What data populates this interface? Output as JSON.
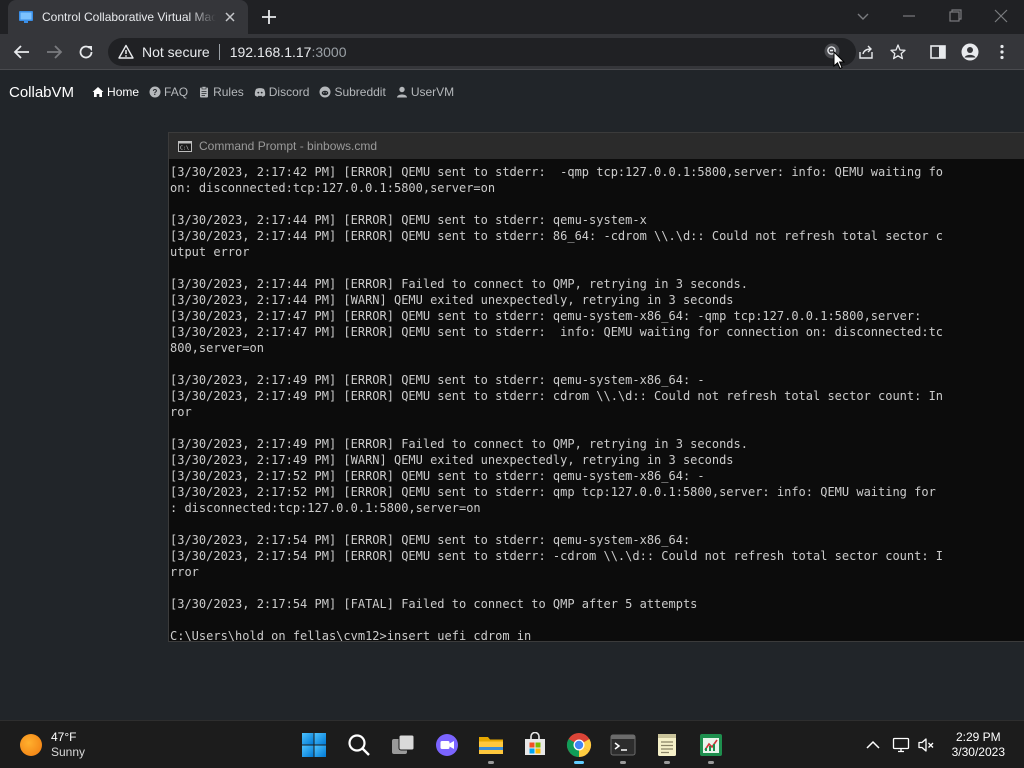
{
  "browser": {
    "tab_title": "Control Collaborative Virtual Machine",
    "security_label": "Not secure",
    "url_host": "192.168.1.17",
    "url_port": ":3000"
  },
  "site": {
    "brand": "CollabVM",
    "nav": [
      {
        "label": "Home",
        "icon": "home-icon"
      },
      {
        "label": "FAQ",
        "icon": "question-icon"
      },
      {
        "label": "Rules",
        "icon": "clipboard-icon"
      },
      {
        "label": "Discord",
        "icon": "discord-icon"
      },
      {
        "label": "Subreddit",
        "icon": "reddit-icon"
      },
      {
        "label": "UserVM",
        "icon": "user-icon"
      }
    ]
  },
  "vm": {
    "window_title": "Command Prompt - binbows.cmd",
    "console_lines": [
      "[3/30/2023, 2:17:42 PM] [ERROR] QEMU sent to stderr:  -qmp tcp:127.0.0.1:5800,server: info: QEMU waiting fo",
      "on: disconnected:tcp:127.0.0.1:5800,server=on",
      "",
      "[3/30/2023, 2:17:44 PM] [ERROR] QEMU sent to stderr: qemu-system-x",
      "[3/30/2023, 2:17:44 PM] [ERROR] QEMU sent to stderr: 86_64: -cdrom \\\\.\\d:: Could not refresh total sector c",
      "utput error",
      "",
      "[3/30/2023, 2:17:44 PM] [ERROR] Failed to connect to QMP, retrying in 3 seconds.",
      "[3/30/2023, 2:17:44 PM] [WARN] QEMU exited unexpectedly, retrying in 3 seconds",
      "[3/30/2023, 2:17:47 PM] [ERROR] QEMU sent to stderr: qemu-system-x86_64: -qmp tcp:127.0.0.1:5800,server:",
      "[3/30/2023, 2:17:47 PM] [ERROR] QEMU sent to stderr:  info: QEMU waiting for connection on: disconnected:tc",
      "800,server=on",
      "",
      "[3/30/2023, 2:17:49 PM] [ERROR] QEMU sent to stderr: qemu-system-x86_64: -",
      "[3/30/2023, 2:17:49 PM] [ERROR] QEMU sent to stderr: cdrom \\\\.\\d:: Could not refresh total sector count: In",
      "ror",
      "",
      "[3/30/2023, 2:17:49 PM] [ERROR] Failed to connect to QMP, retrying in 3 seconds.",
      "[3/30/2023, 2:17:49 PM] [WARN] QEMU exited unexpectedly, retrying in 3 seconds",
      "[3/30/2023, 2:17:52 PM] [ERROR] QEMU sent to stderr: qemu-system-x86_64: -",
      "[3/30/2023, 2:17:52 PM] [ERROR] QEMU sent to stderr: qmp tcp:127.0.0.1:5800,server: info: QEMU waiting for",
      ": disconnected:tcp:127.0.0.1:5800,server=on",
      "",
      "[3/30/2023, 2:17:54 PM] [ERROR] QEMU sent to stderr: qemu-system-x86_64:",
      "[3/30/2023, 2:17:54 PM] [ERROR] QEMU sent to stderr: -cdrom \\\\.\\d:: Could not refresh total sector count: I",
      "rror",
      "",
      "[3/30/2023, 2:17:54 PM] [FATAL] Failed to connect to QMP after 5 attempts",
      "",
      "C:\\Users\\hold on fellas\\cvm12>insert uefi cdrom in"
    ]
  },
  "taskbar": {
    "weather_temp": "47°F",
    "weather_condition": "Sunny",
    "time": "2:29 PM",
    "date": "3/30/2023",
    "apps": [
      "start-icon",
      "search-icon",
      "task-view-icon",
      "chat-icon",
      "file-explorer-icon",
      "store-icon",
      "chrome-icon",
      "terminal-icon",
      "notepad-icon",
      "spreadsheet-icon"
    ]
  },
  "colors": {
    "page_bg": "#212529",
    "console_bg": "#0c0c0c",
    "console_text": "#cccccc",
    "chrome_bg": "#202124",
    "toolbar_bg": "#35363a"
  }
}
